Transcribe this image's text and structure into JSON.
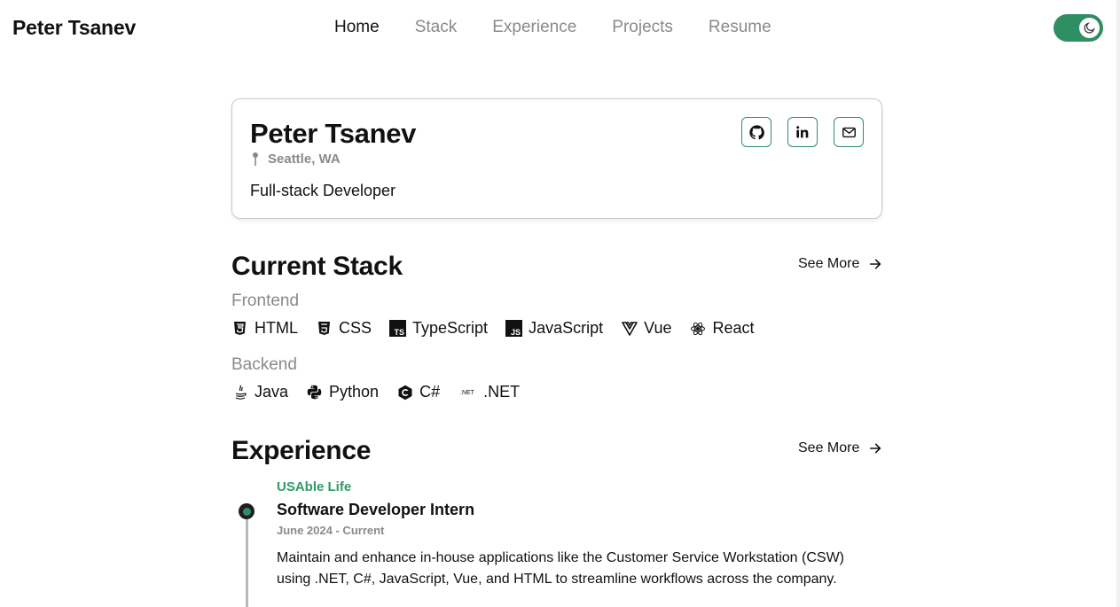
{
  "colors": {
    "accent": "#2f8f62",
    "muted": "#8a8a8a",
    "text": "#111111"
  },
  "navbar": {
    "brand": "Peter Tsanev",
    "links": [
      "Home",
      "Stack",
      "Experience",
      "Projects",
      "Resume"
    ],
    "active_link": "Home",
    "theme_toggle_icon": "moon-icon"
  },
  "profile": {
    "name": "Peter Tsanev",
    "location": "Seattle, WA",
    "role": "Full-stack Developer",
    "socials": [
      "github-icon",
      "linkedin-icon",
      "mail-icon"
    ]
  },
  "stack": {
    "title": "Current Stack",
    "see_more": "See More",
    "frontend_label": "Frontend",
    "frontend": [
      {
        "name": "HTML",
        "icon": "html5-icon"
      },
      {
        "name": "CSS",
        "icon": "css3-icon"
      },
      {
        "name": "TypeScript",
        "icon": "typescript-icon"
      },
      {
        "name": "JavaScript",
        "icon": "javascript-icon"
      },
      {
        "name": "Vue",
        "icon": "vue-icon"
      },
      {
        "name": "React",
        "icon": "react-icon"
      }
    ],
    "backend_label": "Backend",
    "backend": [
      {
        "name": "Java",
        "icon": "java-icon"
      },
      {
        "name": "Python",
        "icon": "python-icon"
      },
      {
        "name": "C#",
        "icon": "csharp-icon"
      },
      {
        "name": ".NET",
        "icon": "dotnet-icon"
      }
    ]
  },
  "experience": {
    "title": "Experience",
    "see_more": "See More",
    "items": [
      {
        "company": "USAble Life",
        "title": "Software Developer Intern",
        "dates": "June 2024 - Current",
        "description": "Maintain and enhance in-house applications like the Customer Service Workstation (CSW) using .NET, C#, JavaScript, Vue, and HTML to streamline workflows across the company."
      }
    ]
  },
  "icon_labels": {
    "dotnet": ".NET",
    "ts": "TS",
    "js": "JS"
  }
}
